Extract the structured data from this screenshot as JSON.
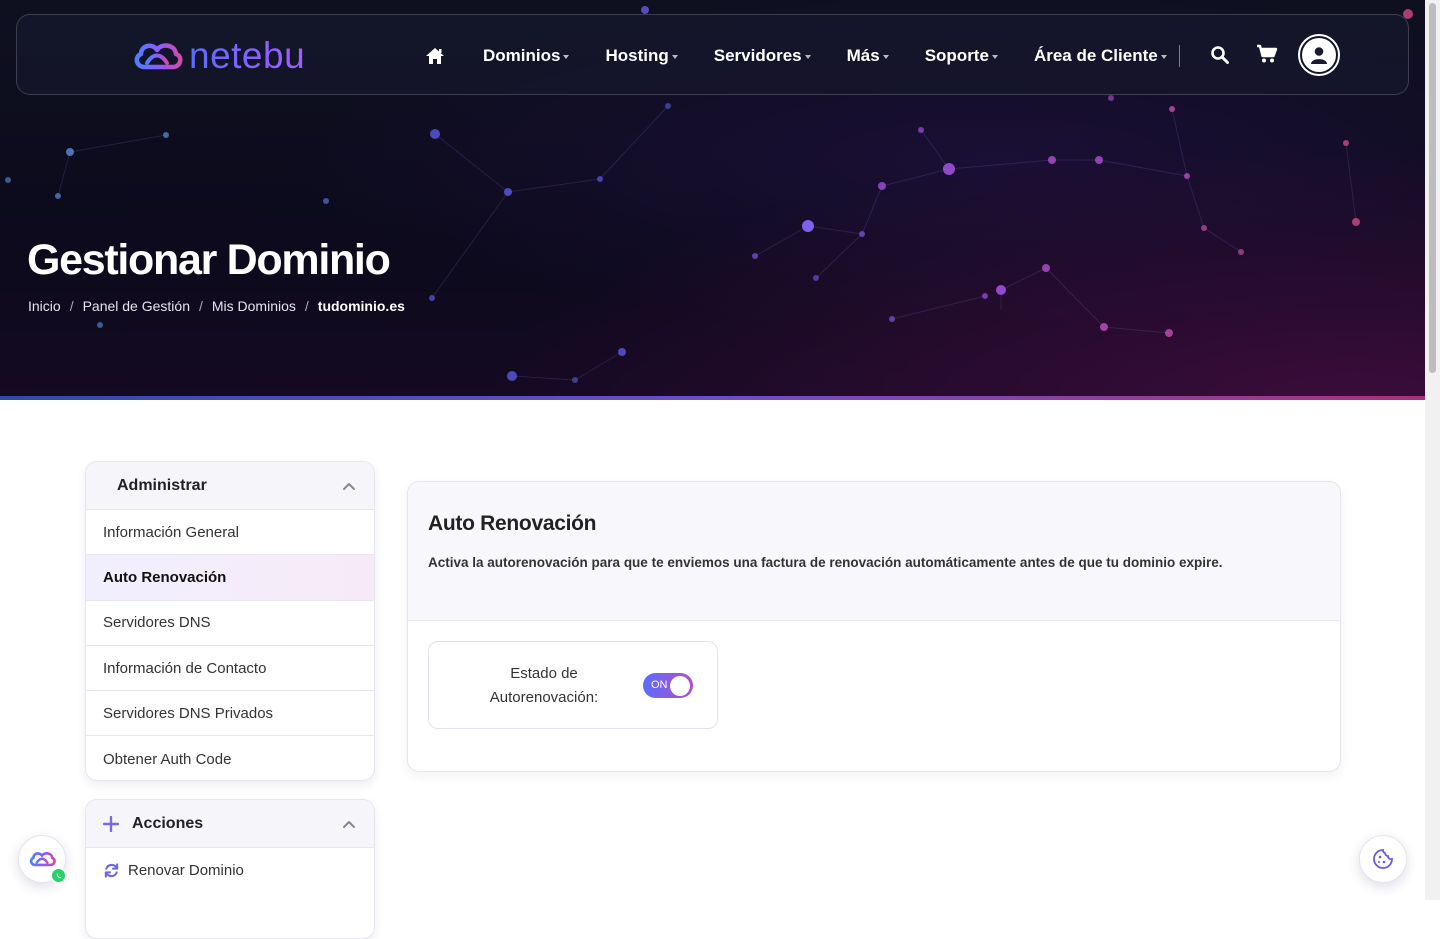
{
  "brand": {
    "name": "netebu"
  },
  "nav": {
    "items": [
      {
        "label": "Dominios"
      },
      {
        "label": "Hosting"
      },
      {
        "label": "Servidores"
      },
      {
        "label": "Más"
      },
      {
        "label": "Soporte"
      },
      {
        "label": "Área de Cliente"
      }
    ]
  },
  "hero": {
    "title": "Gestionar Dominio",
    "breadcrumb": [
      "Inicio",
      "Panel de Gestión",
      "Mis Dominios",
      "tudominio.es"
    ]
  },
  "sidebar": {
    "admin": {
      "title": "Administrar",
      "items": [
        {
          "label": "Información General"
        },
        {
          "label": "Auto Renovación",
          "active": true
        },
        {
          "label": "Servidores DNS"
        },
        {
          "label": "Información de Contacto"
        },
        {
          "label": "Servidores DNS Privados"
        },
        {
          "label": "Obtener Auth Code"
        }
      ]
    },
    "actions": {
      "title": "Acciones",
      "items": [
        {
          "label": "Renovar Dominio"
        }
      ]
    }
  },
  "main": {
    "title": "Auto Renovación",
    "description": "Activa la autorenovación para que te enviemos una factura de renovación automáticamente antes de que tu dominio expire.",
    "status_label_line1": "Estado de",
    "status_label_line2": "Autorenovación:",
    "toggle_label": "ON"
  },
  "colors": {
    "accent_start": "#5b6cff",
    "accent_end": "#b44ec8",
    "hero_bg": "#0c0a1c"
  }
}
